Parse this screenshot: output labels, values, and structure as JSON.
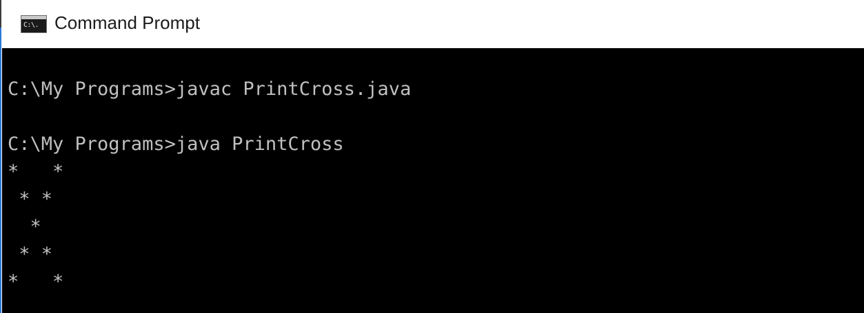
{
  "window": {
    "title": "Command Prompt",
    "icon": "cmd-icon",
    "icon_text": "C:\\."
  },
  "colors": {
    "console_background": "#000000",
    "console_text": "#c0c0c0",
    "titlebar_background": "#ffffff",
    "title_text": "#1b1b1b"
  },
  "console": {
    "lines": [
      "C:\\My Programs>javac PrintCross.java",
      "",
      "C:\\My Programs>java PrintCross",
      "*   *",
      " * *",
      "  *",
      " * *",
      "*   *"
    ]
  }
}
